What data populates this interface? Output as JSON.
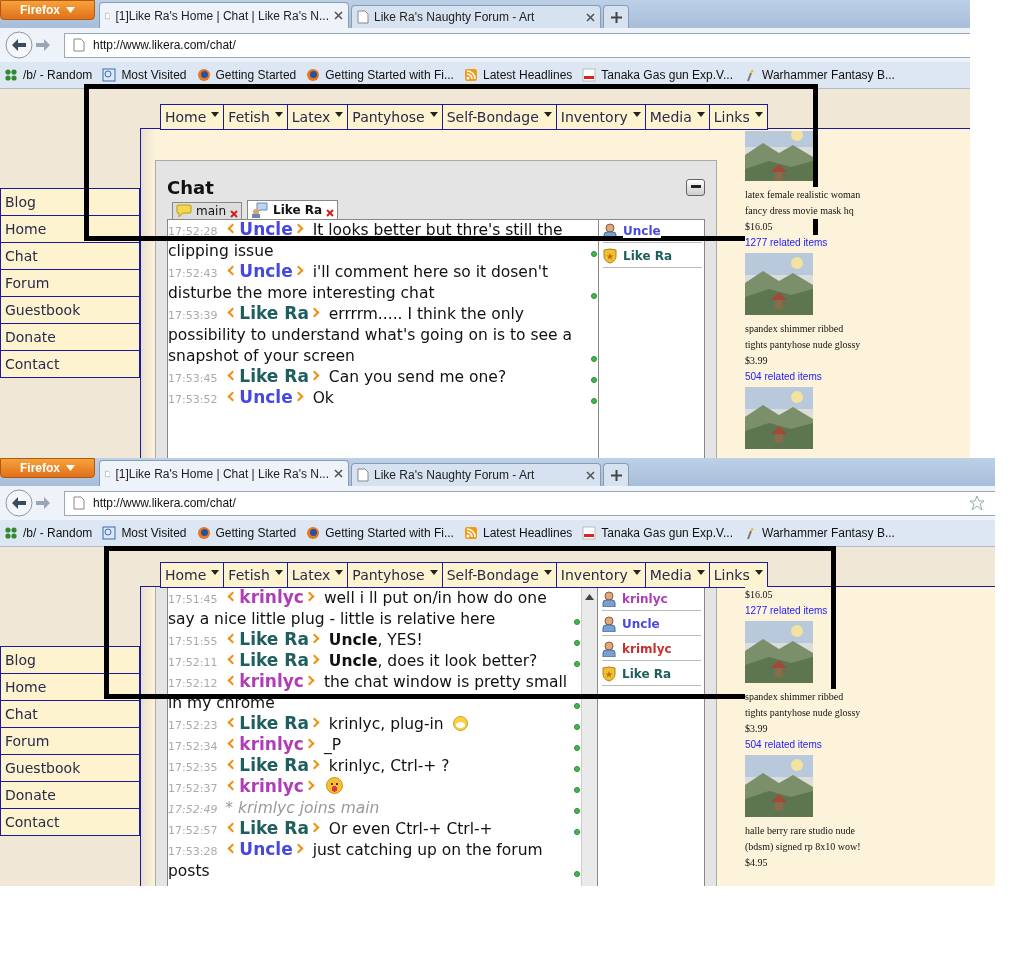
{
  "screens": [
    {
      "browser": {
        "menu_button": "Firefox",
        "tabs": [
          {
            "title": "[1]Like Ra's Home | Chat | Like Ra's N...",
            "selected": true
          },
          {
            "title": "Like Ra's Naughty Forum - Art",
            "selected": false
          }
        ],
        "url": "http://www.likera.com/chat/",
        "show_star": false,
        "bookmarks": [
          {
            "kind": "clover",
            "label": "/b/ - Random"
          },
          {
            "kind": "page",
            "label": "Most Visited"
          },
          {
            "kind": "globe",
            "label": "Getting Started"
          },
          {
            "kind": "globe",
            "label": "Getting Started with Fi..."
          },
          {
            "kind": "rss",
            "label": "Latest Headlines"
          },
          {
            "kind": "logo",
            "label": "Tanaka Gas gun Exp.V..."
          },
          {
            "kind": "torch",
            "label": "Warhammer Fantasy B..."
          }
        ]
      },
      "menu": [
        "Home",
        "Fetish",
        "Latex",
        "Pantyhose",
        "Self-Bondage",
        "Inventory",
        "Media",
        "Links"
      ],
      "sidebar": [
        "Blog",
        "Home",
        "Chat",
        "Forum",
        "Guestbook",
        "Donate",
        "Contact"
      ],
      "chat": {
        "scrolled": false,
        "title": "Chat",
        "tabs": [
          {
            "label": "main",
            "kind": "room",
            "selected": false
          },
          {
            "label": "Like Ra",
            "kind": "private",
            "selected": true
          }
        ],
        "messages": [
          {
            "time": "17:52:28",
            "nick": "Uncle",
            "color": "#4848e0",
            "text": "It looks better but thre's still the clipping issue"
          },
          {
            "time": "17:52:43",
            "nick": "Uncle",
            "color": "#4848e0",
            "text": "i'll comment here so it dosen't disturbe the more interesting chat"
          },
          {
            "time": "17:53:39",
            "nick": "Like Ra",
            "color": "#1e5e5e",
            "text": "errrrm..... I think the only possibility to understand what's going on is to see a snapshot of your screen"
          },
          {
            "time": "17:53:45",
            "nick": "Like Ra",
            "color": "#1e5e5e",
            "text": "Can you send me one?"
          },
          {
            "time": "17:53:52",
            "nick": "Uncle",
            "color": "#4848e0",
            "text": "Ok"
          }
        ],
        "users": [
          {
            "name": "Uncle",
            "kind": "user",
            "color": "#4848e0"
          },
          {
            "name": "Like Ra",
            "kind": "admin",
            "color": "#1e5e5e"
          }
        ]
      },
      "ads": [
        {
          "image": {
            "kind": "picture"
          },
          "lines": [
            "latex female realistic woman",
            "fancy dress movie mask hq"
          ],
          "price": "$16.05",
          "link": "1277 related items"
        },
        {
          "image": {
            "kind": "picture"
          },
          "lines": [
            "spandex shimmer ribbed",
            "tights pantyhose nude glossy"
          ],
          "price": "$3.99",
          "link": "504 related items"
        },
        {
          "image": {
            "kind": "picture"
          }
        }
      ]
    },
    {
      "browser": {
        "menu_button": "Firefox",
        "tabs": [
          {
            "title": "[1]Like Ra's Home | Chat | Like Ra's N...",
            "selected": true
          },
          {
            "title": "Like Ra's Naughty Forum - Art",
            "selected": false
          }
        ],
        "url": "http://www.likera.com/chat/",
        "show_star": true,
        "bookmarks": [
          {
            "kind": "clover",
            "label": "/b/ - Random"
          },
          {
            "kind": "page",
            "label": "Most Visited"
          },
          {
            "kind": "globe",
            "label": "Getting Started"
          },
          {
            "kind": "globe",
            "label": "Getting Started with Fi..."
          },
          {
            "kind": "rss",
            "label": "Latest Headlines"
          },
          {
            "kind": "logo",
            "label": "Tanaka Gas gun Exp.V..."
          },
          {
            "kind": "torch",
            "label": "Warhammer Fantasy B..."
          }
        ]
      },
      "menu": [
        "Home",
        "Fetish",
        "Latex",
        "Pantyhose",
        "Self-Bondage",
        "Inventory",
        "Media",
        "Links"
      ],
      "sidebar": [
        "Blog",
        "Home",
        "Chat",
        "Forum",
        "Guestbook",
        "Donate",
        "Contact"
      ],
      "chat": {
        "scrolled": true,
        "messages": [
          {
            "time": "17:51:45",
            "nick": "krinlyc",
            "color": "#b03cb8",
            "text": "well i ll put on/in how do one say a nice little plug - little is relative here"
          },
          {
            "time": "17:51:55",
            "nick": "Like Ra",
            "color": "#1e5e5e",
            "text": "**Uncle**, YES!"
          },
          {
            "time": "17:52:11",
            "nick": "Like Ra",
            "color": "#1e5e5e",
            "text": "**Uncle**, does it look better?"
          },
          {
            "time": "17:52:12",
            "nick": "krinlyc",
            "color": "#b03cb8",
            "text": "the chat window is pretty small in my chrome"
          },
          {
            "time": "17:52:23",
            "nick": "Like Ra",
            "color": "#1e5e5e",
            "text": "krinlyc, plug-in",
            "emoticon": {
              "kind": "grin"
            }
          },
          {
            "time": "17:52:34",
            "nick": "krinlyc",
            "color": "#b03cb8",
            "text": "_P"
          },
          {
            "time": "17:52:35",
            "nick": "Like Ra",
            "color": "#1e5e5e",
            "text": "krinlyc, Ctrl-+ ?"
          },
          {
            "time": "17:52:37",
            "nick": "krinlyc",
            "color": "#b03cb8",
            "emoticon": {
              "kind": "tongue"
            }
          },
          {
            "time": "17:52:49",
            "kind": "action",
            "text": "* krimlyc joins main"
          },
          {
            "time": "17:52:57",
            "nick": "Like Ra",
            "color": "#1e5e5e",
            "text": "Or even Ctrl-+ Ctrl-+"
          },
          {
            "time": "17:53:28",
            "nick": "Uncle",
            "color": "#4848e0",
            "text": "just catching up on the forum posts"
          }
        ],
        "users": [
          {
            "name": "krinlyc",
            "kind": "user",
            "color": "#b03cb8"
          },
          {
            "name": "Uncle",
            "kind": "user",
            "color": "#4848e0"
          },
          {
            "name": "krimlyc",
            "kind": "user",
            "color": "#c83030"
          },
          {
            "name": "Like Ra",
            "kind": "admin",
            "color": "#1e5e5e"
          }
        ]
      },
      "ads": [
        {
          "price": "$16.05",
          "link": "1277 related items"
        },
        {
          "image": {
            "kind": "picture"
          },
          "lines": [
            "spandex shimmer ribbed",
            "tights pantyhose nude glossy"
          ],
          "price": "$3.99",
          "link": "504 related items"
        },
        {
          "image": {
            "kind": "picture"
          },
          "lines": [
            "halle berry rare studio nude",
            "(bdsm) signed rp 8x10 wow!"
          ],
          "price": "$4.95"
        }
      ]
    }
  ]
}
